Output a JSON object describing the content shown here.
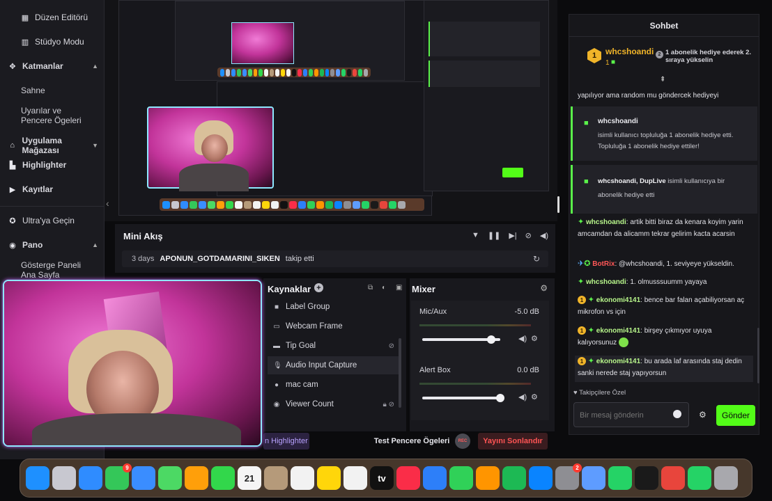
{
  "sidebar": {
    "items": [
      {
        "label": "Düzen Editörü",
        "icon": "layout-grid-icon"
      },
      {
        "label": "Stüdyo Modu",
        "icon": "columns-icon"
      },
      {
        "label": "Katmanlar",
        "icon": "layers-icon"
      },
      {
        "label": "Sahne",
        "icon": ""
      },
      {
        "label": "Uyarılar ve Pencere Ögeleri",
        "icon": ""
      },
      {
        "label": "Uygulama Mağazası",
        "icon": "store-icon"
      },
      {
        "label": "Highlighter",
        "icon": "highlighter-icon"
      },
      {
        "label": "Kayıtlar",
        "icon": "play-circle-icon"
      },
      {
        "label": "Ultra'ya Geçin",
        "icon": "ultra-icon"
      },
      {
        "label": "Pano",
        "icon": "dashboard-icon"
      },
      {
        "label": "Gösterge Paneli Ana Sayfa",
        "icon": ""
      }
    ]
  },
  "mini_feed": {
    "title": "Mini Akış",
    "event": {
      "time": "3 days",
      "user": "APONUN_GOTDAMARINI_SIKEN",
      "action": "takip etti"
    }
  },
  "sources": {
    "title": "Kaynaklar",
    "items": [
      "Label Group",
      "Webcam Frame",
      "Tip Goal",
      "Audio Input Capture",
      "mac cam",
      "Viewer Count"
    ]
  },
  "mixer": {
    "title": "Mixer",
    "channels": [
      {
        "name": "Mic/Aux",
        "db": "-5.0 dB",
        "level": 0.88
      },
      {
        "name": "Alert Box",
        "db": "0.0 dB",
        "level": 1.0
      }
    ]
  },
  "bottom_bar": {
    "highlighter": "n Highlighter",
    "test": "Test Pencere Ögeleri",
    "rec": "REC",
    "end_stream": "Yayını Sonlandır"
  },
  "chat": {
    "header": "Sohbet",
    "top_gifter": {
      "user": "whcshoandi",
      "count": "1",
      "rank_badge": "1",
      "next_rank": "2",
      "next_text": "1 abonelik hediye ederek 2. sıraya yükselin"
    },
    "partial_msg": "yapılıyor ama random mu göndercek hediyeyi",
    "gift1": {
      "user": "whcshoandi",
      "text": "isimli kullanıcı topluluğa 1 abonelik hediye etti. Topluluğa 1 abonelik hediye ettiler!"
    },
    "gift2": {
      "user": "whcshoandi, DupLive",
      "text": " isimli kullanıcıya bir abonelik hediye etti"
    },
    "messages": [
      {
        "user": "whcshoandi",
        "text": " artik bitti biraz da kenara koyim yarin amcamdan da alicamm tekrar gelirim kacta acarsin"
      },
      {
        "user": "BotRix",
        "text": " @whcshoandi, 1. seviyeye yükseldin."
      },
      {
        "user": "whcshoandi",
        "text": " 1. olmusssuumm yayaya"
      },
      {
        "user": "ekonomi4141",
        "text": " bence bar falan açabiliyorsan aç mikrofon vs için",
        "badge": "1"
      },
      {
        "user": "ekonomi4141",
        "text": " birşey çıkmıyor uyuya kalıyorsunuz",
        "badge": "1"
      },
      {
        "user": "ekonomi4141",
        "text": " bu arada laf arasında staj dedin sanki nerede staj yapıyorsun",
        "badge": "1"
      }
    ],
    "followers_only": "Takipçilere Özel",
    "input_placeholder": "Bir mesaj gönderin",
    "send": "Gönder",
    "emote_alt": "smiley-emote"
  },
  "dock": {
    "apps": [
      {
        "name": "finder",
        "color": "#1e90ff"
      },
      {
        "name": "launchpad",
        "color": "#c8c8d0"
      },
      {
        "name": "safari",
        "color": "#2f8cff"
      },
      {
        "name": "messages",
        "color": "#34c759",
        "badge": "9"
      },
      {
        "name": "mail",
        "color": "#3a8dff"
      },
      {
        "name": "maps",
        "color": "#4cd964"
      },
      {
        "name": "photos",
        "color": "#ff9f0a"
      },
      {
        "name": "facetime",
        "color": "#32d74b"
      },
      {
        "name": "calendar",
        "color": "#f5f5f5",
        "label": "21"
      },
      {
        "name": "contacts",
        "color": "#b59a7a"
      },
      {
        "name": "reminders",
        "color": "#f2f2f2"
      },
      {
        "name": "notes",
        "color": "#ffd60a"
      },
      {
        "name": "freeform",
        "color": "#f2f2f2"
      },
      {
        "name": "tv",
        "color": "#111111",
        "label": "tv"
      },
      {
        "name": "music",
        "color": "#fa2d48"
      },
      {
        "name": "keynote",
        "color": "#2d7ff9"
      },
      {
        "name": "numbers",
        "color": "#30d158"
      },
      {
        "name": "pages",
        "color": "#ff9500"
      },
      {
        "name": "spotify",
        "color": "#1db954"
      },
      {
        "name": "app-store",
        "color": "#0a84ff"
      },
      {
        "name": "system-settings",
        "color": "#8e8e93",
        "badge": "2"
      },
      {
        "name": "preview",
        "color": "#5e9cff"
      },
      {
        "name": "whatsapp",
        "color": "#25d366"
      },
      {
        "name": "kick",
        "color": "#1a1a1a"
      },
      {
        "name": "chrome",
        "color": "#e8453c"
      },
      {
        "name": "whatsapp-2",
        "color": "#25d366"
      },
      {
        "name": "trash",
        "color": "#a8a8ad"
      }
    ]
  }
}
